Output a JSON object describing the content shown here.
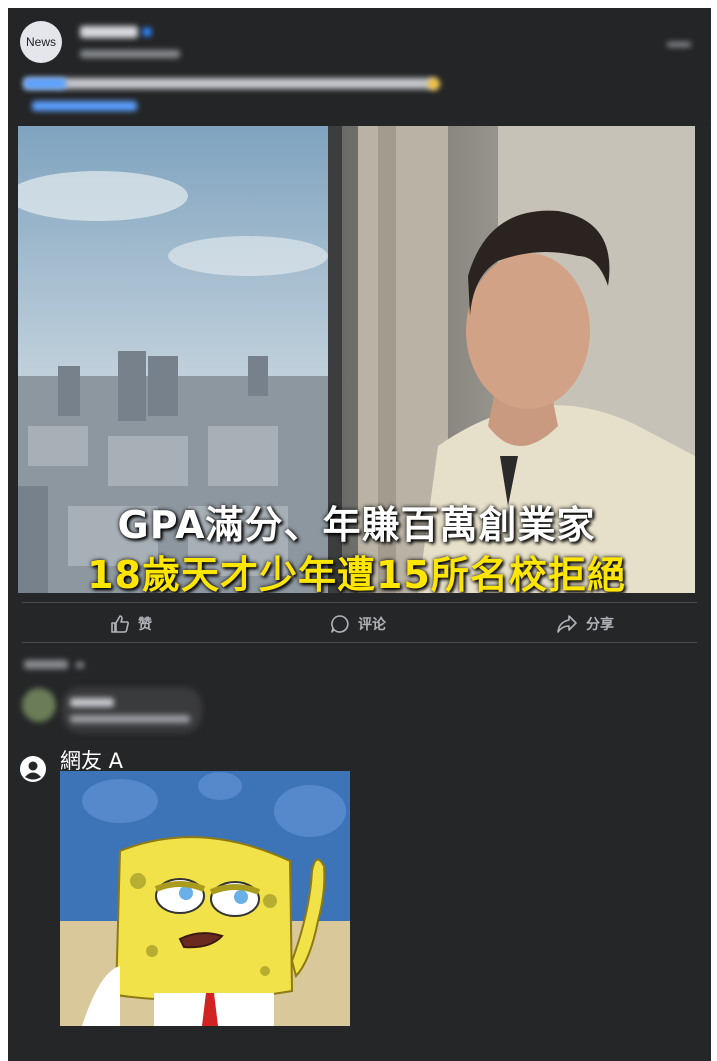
{
  "post": {
    "page_avatar_text": "News",
    "page_name": "",
    "image": {
      "caption_line1": "GPA滿分、年賺百萬創業家",
      "caption_line2": "18歲天才少年遭15所名校拒絕"
    }
  },
  "actions": {
    "like": "赞",
    "comment": "评论",
    "share": "分享"
  },
  "reply": {
    "user_name": "網友 A"
  },
  "colors": {
    "background": "#252628",
    "caption_white": "#ffffff",
    "caption_yellow": "#ffe600",
    "action_text": "#b0b3b8"
  }
}
